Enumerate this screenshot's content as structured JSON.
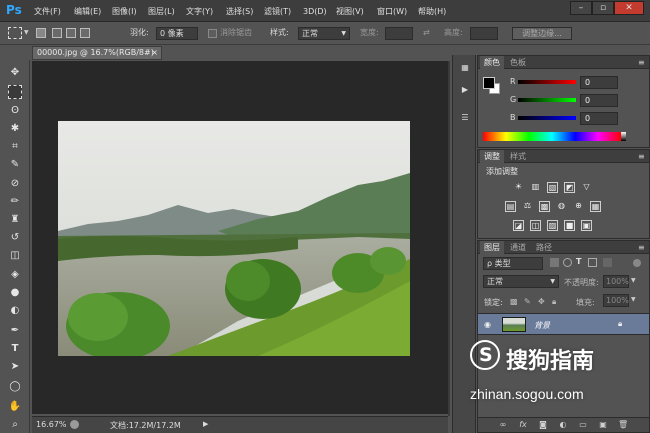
{
  "app": {
    "logo": "Ps"
  },
  "menu": [
    "文件(F)",
    "编辑(E)",
    "图像(I)",
    "图层(L)",
    "文字(Y)",
    "选择(S)",
    "滤镜(T)",
    "3D(D)",
    "视图(V)",
    "窗口(W)",
    "帮助(H)"
  ],
  "window_controls": {
    "minimize": "–",
    "restore": "▫",
    "close": "✕"
  },
  "options": {
    "feather_label": "羽化:",
    "feather_value": "0 像素",
    "antialias_label": "消除锯齿",
    "style_label": "样式:",
    "style_value": "正常",
    "width_label": "宽度:",
    "height_label": "高度:",
    "refine_button": "调整边缘..."
  },
  "document": {
    "tab_title": "00000.jpg @ 16.7%(RGB/8#)",
    "tab_close": "×",
    "zoom": "16.67%",
    "doc_info": "文档:17.2M/17.2M"
  },
  "color_panel": {
    "tabs": [
      "颜色",
      "色板"
    ],
    "channels": [
      {
        "label": "R",
        "value": "0",
        "color": "#e02020"
      },
      {
        "label": "G",
        "value": "0",
        "color": "#20c020"
      },
      {
        "label": "B",
        "value": "0",
        "color": "#2040e0"
      }
    ]
  },
  "adjust_panel": {
    "tabs": [
      "调整",
      "样式"
    ],
    "title": "添加调整",
    "row1": [
      "☀",
      "▥",
      "▧",
      "◩",
      "▽"
    ],
    "row2": [
      "▤",
      "⚖",
      "▩",
      "◍",
      "⊕",
      "▦"
    ],
    "row3": [
      "◪",
      "◫",
      "▨",
      "■",
      "▣"
    ]
  },
  "layers_panel": {
    "tabs": [
      "图层",
      "通道",
      "路径"
    ],
    "filter_label": "ρ 类型",
    "blend_mode": "正常",
    "opacity_label": "不透明度:",
    "opacity_value": "100%",
    "lock_label": "锁定:",
    "fill_label": "填充:",
    "fill_value": "100%",
    "layers": [
      {
        "name": "背景",
        "visible": true,
        "locked": true
      }
    ]
  },
  "watermark": {
    "brand": "搜狗指南",
    "url": "zhinan.sogou.com"
  }
}
